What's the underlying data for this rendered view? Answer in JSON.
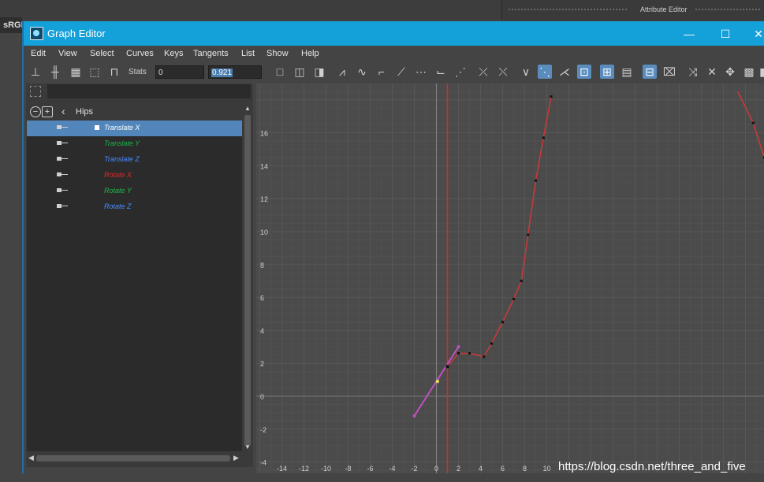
{
  "background": {
    "tab_label": "sRGB",
    "attribute_editor_label": "Attribute Editor"
  },
  "window": {
    "title": "Graph Editor",
    "controls": {
      "minimize": "—",
      "maximize": "☐",
      "close": "✕"
    }
  },
  "menu": [
    "Edit",
    "View",
    "Select",
    "Curves",
    "Keys",
    "Tangents",
    "List",
    "Show",
    "Help"
  ],
  "toolbar": {
    "stats_label": "Stats",
    "stats_value1": "0",
    "stats_value2": "0.921"
  },
  "outliner": {
    "parent": "Hips",
    "channels": [
      {
        "name": "Translate X",
        "color": "#ffffff",
        "selected": true
      },
      {
        "name": "Translate Y",
        "color": "#1fb64a",
        "selected": false
      },
      {
        "name": "Translate Z",
        "color": "#4a8cff",
        "selected": false
      },
      {
        "name": "Rotate X",
        "color": "#e02828",
        "selected": false
      },
      {
        "name": "Rotate Y",
        "color": "#1fb64a",
        "selected": false
      },
      {
        "name": "Rotate Z",
        "color": "#4a8cff",
        "selected": false
      }
    ]
  },
  "graph": {
    "x_ticks": [
      "-14",
      "-12",
      "-10",
      "-8",
      "-6",
      "-4",
      "-2",
      "0",
      "2",
      "4",
      "6",
      "8",
      "10"
    ],
    "y_ticks": [
      "16",
      "14",
      "12",
      "10",
      "8",
      "6",
      "4",
      "2",
      "0",
      "-2",
      "-4"
    ],
    "current_frame": 1,
    "curve_color": "#c83a3a",
    "tangent_color": "#c050c0"
  },
  "watermark": "https://blog.csdn.net/three_and_five"
}
